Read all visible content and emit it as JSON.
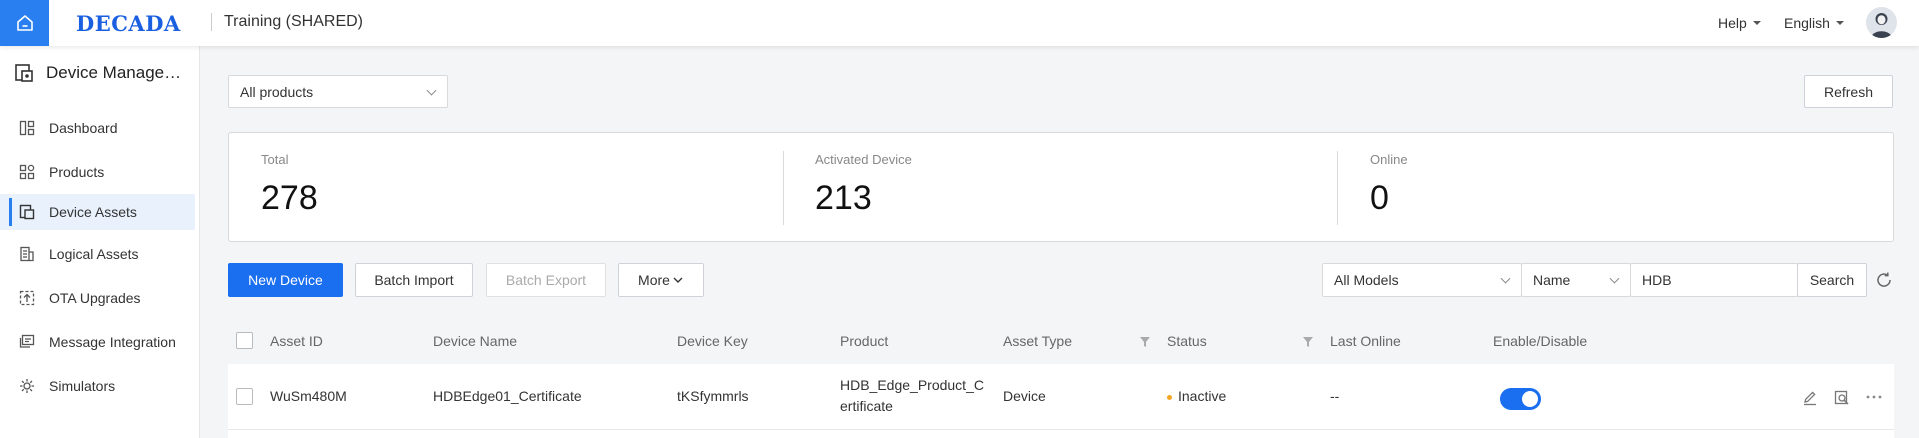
{
  "header": {
    "logo": "DECADA",
    "workspace": "Training (SHARED)",
    "help_label": "Help",
    "language_label": "English"
  },
  "sidebar": {
    "title": "Device Managem...",
    "items": [
      {
        "label": "Dashboard",
        "icon": "dashboard-icon"
      },
      {
        "label": "Products",
        "icon": "products-icon"
      },
      {
        "label": "Device Assets",
        "icon": "device-assets-icon",
        "active": true
      },
      {
        "label": "Logical Assets",
        "icon": "logical-assets-icon"
      },
      {
        "label": "OTA Upgrades",
        "icon": "ota-icon"
      },
      {
        "label": "Message Integration",
        "icon": "message-icon"
      },
      {
        "label": "Simulators",
        "icon": "simulators-icon"
      }
    ]
  },
  "filters": {
    "product_select": "All products",
    "refresh_label": "Refresh"
  },
  "stats": {
    "total_label": "Total",
    "total_value": "278",
    "activated_label": "Activated Device",
    "activated_value": "213",
    "online_label": "Online",
    "online_value": "0"
  },
  "toolbar": {
    "new_device": "New Device",
    "batch_import": "Batch Import",
    "batch_export": "Batch Export",
    "more": "More",
    "model_select": "All Models",
    "field_select": "Name",
    "search_value": "HDB",
    "search_button": "Search"
  },
  "table": {
    "columns": [
      "Asset ID",
      "Device Name",
      "Device Key",
      "Product",
      "Asset Type",
      "Status",
      "Last Online",
      "Enable/Disable"
    ],
    "rows": [
      {
        "asset_id": "WuSm480M",
        "device_name": "HDBEdge01_Certificate",
        "device_key": "tKSfymmrls",
        "product_line1": "HDB_Edge_Product_C",
        "product_line2": "ertificate",
        "asset_type": "Device",
        "status": "Inactive",
        "last_online": "--",
        "enabled": true
      }
    ]
  },
  "colors": {
    "accent": "#1a6ef0",
    "status_inactive": "#f5a623",
    "sidebar_active_bg": "#e9f1fd"
  }
}
